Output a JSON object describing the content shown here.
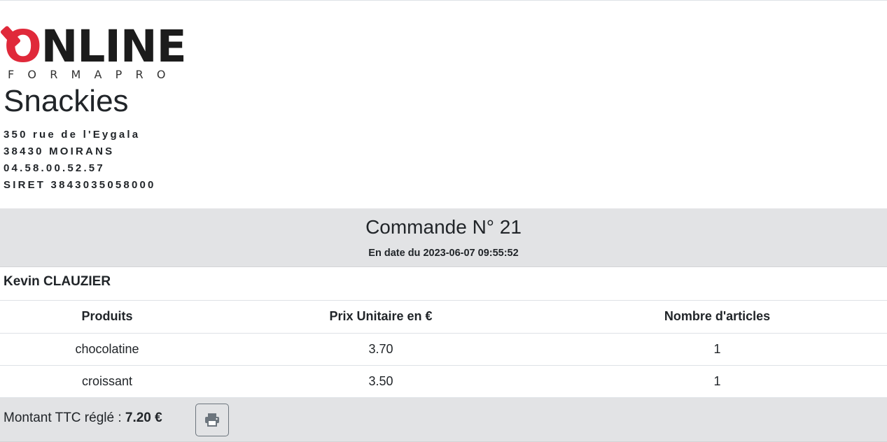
{
  "logo": {
    "word_first": "O",
    "word_rest": "NLINE",
    "tagline": "FORMAPRO"
  },
  "shop": {
    "name": "Snackies",
    "address_line1": "350 rue de l'Eygala",
    "address_line2": "38430 MOIRANS",
    "phone": "04.58.00.52.57",
    "siret": "SIRET 3843035058000"
  },
  "order": {
    "title": "Commande N° 21",
    "date": "En date du 2023-06-07 09:55:52",
    "client": "Kevin CLAUZIER"
  },
  "table": {
    "headers": [
      "Produits",
      "Prix Unitaire en €",
      "Nombre d'articles"
    ],
    "rows": [
      [
        "chocolatine",
        "3.70",
        "1"
      ],
      [
        "croissant",
        "3.50",
        "1"
      ]
    ]
  },
  "footer": {
    "total_label": "Montant TTC réglé : ",
    "total_value": "7.20 €",
    "print_icon": "print-icon"
  },
  "colors": {
    "logo_red": "#e0293a",
    "banner_gray": "#e2e3e5"
  }
}
